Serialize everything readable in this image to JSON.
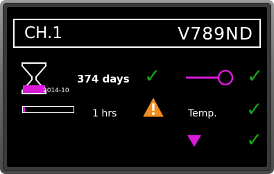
{
  "header": {
    "channel": "CH.1",
    "device_id": "V789ND"
  },
  "hourglass": {
    "date": "2014-10"
  },
  "status": {
    "days_text": "374 days",
    "hrs_text": "1 hrs",
    "temp_label": "Temp.",
    "progress_fraction": 0.04
  },
  "icons": {
    "check_glyph": "✓",
    "hourglass": "hourglass-icon",
    "warning": "warning-icon",
    "sensor": "sensor-probe-icon",
    "arrow": "arrow-down-icon"
  },
  "colors": {
    "accent_magenta": "#d81ad8",
    "ok_green": "#1aa81a",
    "warning_orange": "#f28c1a",
    "screen_bg": "#000000"
  }
}
